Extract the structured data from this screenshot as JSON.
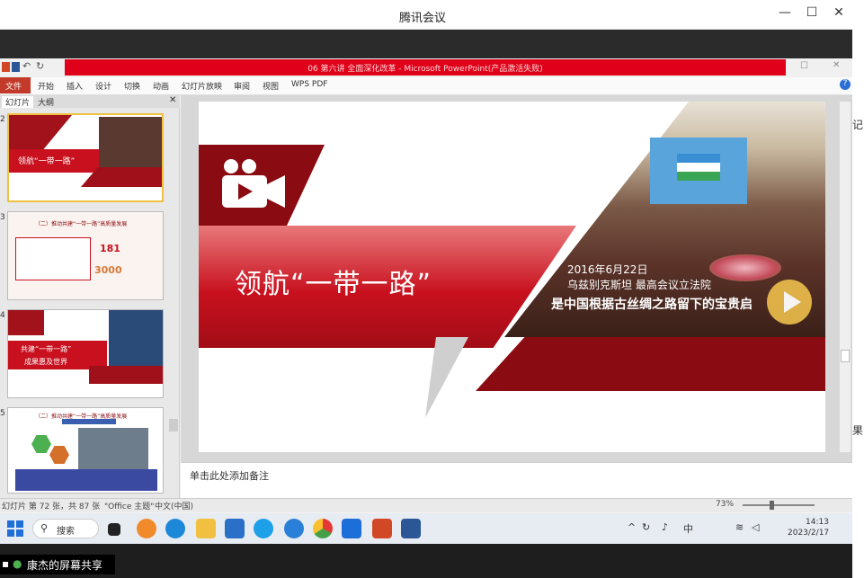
{
  "meeting_window": {
    "title": "腾讯会议",
    "minimize": "—",
    "maximize": "☐",
    "close": "✕"
  },
  "right_strip": {
    "t1": "记",
    "t2": "果"
  },
  "ppt": {
    "title": "06 第六讲 全面深化改革 - Microsoft PowerPoint(产品激活失败)",
    "menus": [
      "文件",
      "开始",
      "插入",
      "设计",
      "切换",
      "动画",
      "幻灯片放映",
      "审阅",
      "视图",
      "WPS PDF"
    ],
    "panel_tabs": {
      "slides": "幻灯片",
      "outline": "大纲"
    },
    "slide_numbers": [
      "2",
      "3",
      "4",
      "5"
    ],
    "notes_placeholder": "单击此处添加备注",
    "status": {
      "slide_info": "幻灯片 第 72 张，共 87 张",
      "theme": "\"Office 主题\"",
      "lang": "中文(中国)",
      "zoom": "73%"
    }
  },
  "slide": {
    "title": "领航“一带一路”",
    "date": "2016年6月22日",
    "location": "乌兹别克斯坦 最高会议立法院",
    "caption": "是中国根据古丝绸之路留下的宝贵启"
  },
  "thumbs": {
    "t2_text": "领航“一带一路”",
    "t3_heading": "（二）推动共建“一带一路”高质量发展",
    "t3_n1": "181",
    "t3_n2": "3000",
    "t4_text1": "共建“一带一路”",
    "t4_text2": "成果惠及世界",
    "t5_heading": "（二）推动共建“一带一路”高质量发展"
  },
  "taskbar": {
    "search": "搜索",
    "time": "14:13",
    "date": "2023/2/17",
    "tray_lang": "中"
  },
  "share": {
    "label": "康杰的屏幕共享"
  },
  "colors": {
    "accent_red": "#c8101e",
    "dark_red": "#8a0c12"
  }
}
